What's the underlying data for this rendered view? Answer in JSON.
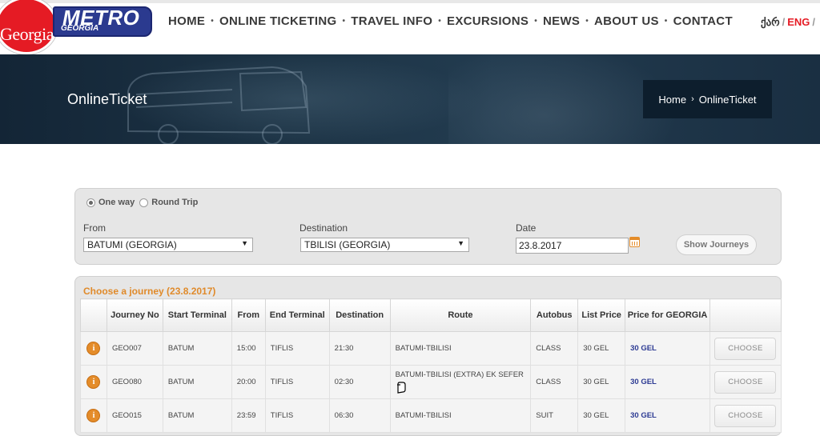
{
  "logo": {
    "circle_text": "Georgia",
    "brand": "METRO",
    "sub": "GEORGIA"
  },
  "nav": {
    "items": [
      "HOME",
      "ONLINE TICKETING",
      "TRAVEL INFO",
      "EXCURSIONS",
      "NEWS",
      "ABOUT US",
      "CONTACT"
    ],
    "separator": "•"
  },
  "lang": {
    "geo": "ქარ",
    "sep": "/",
    "eng": "ENG",
    "sep2": "/"
  },
  "banner": {
    "title": "OnlineTicket"
  },
  "breadcrumb": {
    "home": "Home",
    "arrow": "›",
    "current": "OnlineTicket"
  },
  "search": {
    "one_way_label": "One way",
    "round_trip_label": "Round Trip",
    "from_label": "From",
    "from_value": "BATUMI (GEORGIA)",
    "destination_label": "Destination",
    "destination_value": "TBILISI (GEORGIA)",
    "date_label": "Date",
    "date_value": "23.8.2017",
    "show_button": "Show Journeys"
  },
  "results": {
    "title": "Choose a journey (23.8.2017)",
    "columns": [
      "Journey No",
      "Start Terminal",
      "From",
      "End Terminal",
      "Destination",
      "Route",
      "Autobus",
      "List Price",
      "Price for GEORGIA"
    ],
    "choose_label": "CHOOSE",
    "rows": [
      {
        "no": "GEO007",
        "start": "BATUM",
        "from": "15:00",
        "end": "TIFLIS",
        "dest": "21:30",
        "route": "BATUMI-TBILISI",
        "autobus": "CLASS",
        "list_price": "30 GEL",
        "price": "30 GEL"
      },
      {
        "no": "GEO080",
        "start": "BATUM",
        "from": "20:00",
        "end": "TIFLIS",
        "dest": "02:30",
        "route": "BATUMI-TBILISI (EXTRA) EK SEFER",
        "autobus": "CLASS",
        "list_price": "30 GEL",
        "price": "30 GEL"
      },
      {
        "no": "GEO015",
        "start": "BATUM",
        "from": "23:59",
        "end": "TIFLIS",
        "dest": "06:30",
        "route": "BATUMI-TBILISI",
        "autobus": "SUIT",
        "list_price": "30 GEL",
        "price": "30 GEL"
      }
    ]
  },
  "colors": {
    "accent": "#e08a2a",
    "brand_red": "#e51b24",
    "brand_blue": "#2b3a8f",
    "price_blue": "#2c3a93",
    "banner_dark": "#0d1e2d"
  }
}
